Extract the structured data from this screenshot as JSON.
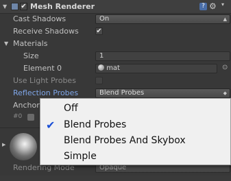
{
  "header": {
    "enabled": true,
    "title": "Mesh Renderer",
    "help_icon": "?",
    "settings_icon": "gear-icon"
  },
  "fields": {
    "cast_shadows": {
      "label": "Cast Shadows",
      "value": "On"
    },
    "receive_shadows": {
      "label": "Receive Shadows",
      "checked": true,
      "check_glyph": "✔"
    },
    "materials": {
      "label": "Materials"
    },
    "size": {
      "label": "Size",
      "value": "1"
    },
    "element0": {
      "label": "Element 0",
      "value": "mat"
    },
    "use_light_probes": {
      "label": "Use Light Probes",
      "checked": false
    },
    "reflection_probes": {
      "label": "Reflection Probes",
      "value": "Blend Probes"
    },
    "anchor_override": {
      "label": "Anchor"
    },
    "preview_index": {
      "label": "#0"
    },
    "rendering_mode": {
      "label": "Rendering Mode",
      "value": "Opaque"
    }
  },
  "popup_menu": {
    "selected": "Blend Probes",
    "check_glyph": "✔",
    "items": [
      {
        "label": "Off",
        "checked": false
      },
      {
        "label": "Blend Probes",
        "checked": true
      },
      {
        "label": "Blend Probes And Skybox",
        "checked": false
      },
      {
        "label": "Simple",
        "checked": false
      }
    ]
  }
}
